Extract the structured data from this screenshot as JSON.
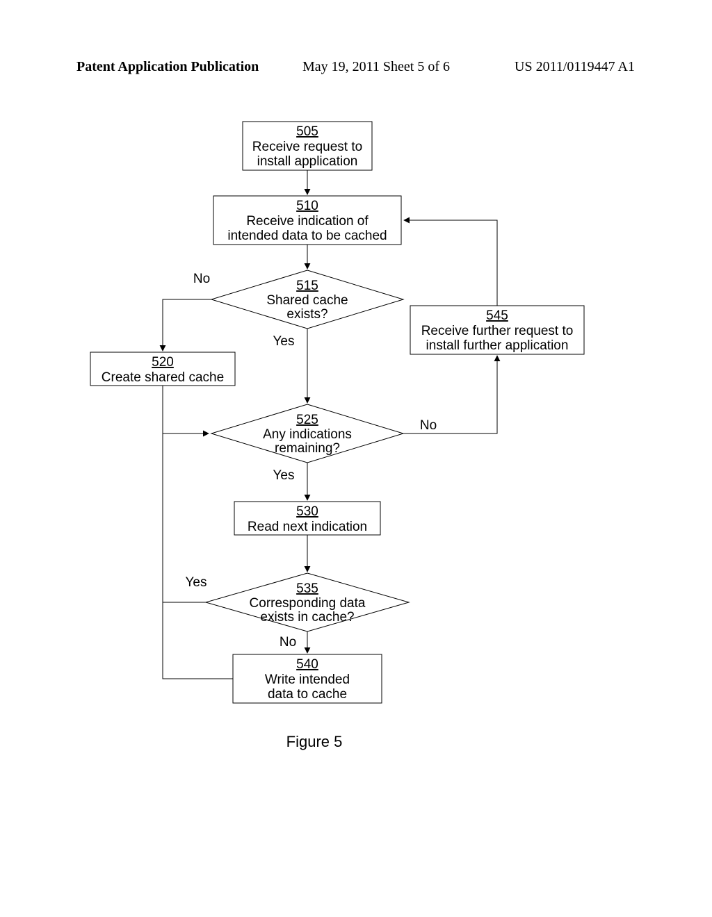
{
  "header": {
    "left": "Patent Application Publication",
    "center": "May 19, 2011  Sheet 5 of 6",
    "right": "US 2011/0119447 A1"
  },
  "figure_label": "Figure 5",
  "labels": {
    "no1": "No",
    "yes1": "Yes",
    "no2": "No",
    "yes2": "Yes",
    "yes3": "Yes",
    "no3": "No"
  },
  "nodes": {
    "n505": {
      "num": "505",
      "l1": "Receive request to",
      "l2": "install application"
    },
    "n510": {
      "num": "510",
      "l1": "Receive indication of",
      "l2": "intended data to be cached"
    },
    "n515": {
      "num": "515",
      "l1": "Shared cache",
      "l2": "exists?"
    },
    "n520": {
      "num": "520",
      "l1": "Create shared cache"
    },
    "n525": {
      "num": "525",
      "l1": "Any indications",
      "l2": "remaining?"
    },
    "n530": {
      "num": "530",
      "l1": "Read next indication"
    },
    "n535": {
      "num": "535",
      "l1": "Corresponding data",
      "l2": "exists in cache?"
    },
    "n540": {
      "num": "540",
      "l1": "Write intended",
      "l2": "data to cache"
    },
    "n545": {
      "num": "545",
      "l1": "Receive further request to",
      "l2": "install further application"
    }
  }
}
